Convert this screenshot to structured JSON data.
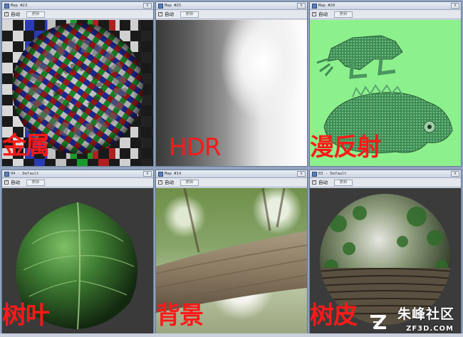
{
  "windows": [
    {
      "title": "Map #23",
      "auto_label": "自动",
      "update_label": "更新",
      "caption": "金属",
      "close_glyph": "x",
      "check_glyph": "✓"
    },
    {
      "title": "Map #25",
      "auto_label": "自动",
      "update_label": "更新",
      "caption": "HDR",
      "close_glyph": "x",
      "check_glyph": "✓"
    },
    {
      "title": "Map #20",
      "auto_label": "自动",
      "update_label": "更新",
      "caption": "漫反射",
      "close_glyph": "x",
      "check_glyph": "✓"
    },
    {
      "title": "04 - Default",
      "auto_label": "自动",
      "update_label": "更新",
      "caption": "树叶",
      "close_glyph": "x",
      "check_glyph": "✓"
    },
    {
      "title": "Map #14",
      "auto_label": "自动",
      "update_label": "更新",
      "caption": "背景",
      "close_glyph": "x",
      "check_glyph": "✓"
    },
    {
      "title": "03 - Default",
      "auto_label": "自动",
      "update_label": "更新",
      "caption": "树皮",
      "close_glyph": "x",
      "check_glyph": "✓"
    }
  ],
  "watermark": {
    "name_cn": "朱峰社区",
    "domain": "ZF3D.COM"
  },
  "colors": {
    "caption": "#ff1a1a",
    "iguana_bg": "#8cf08c",
    "viewport_dark": "#3a3a3a"
  }
}
